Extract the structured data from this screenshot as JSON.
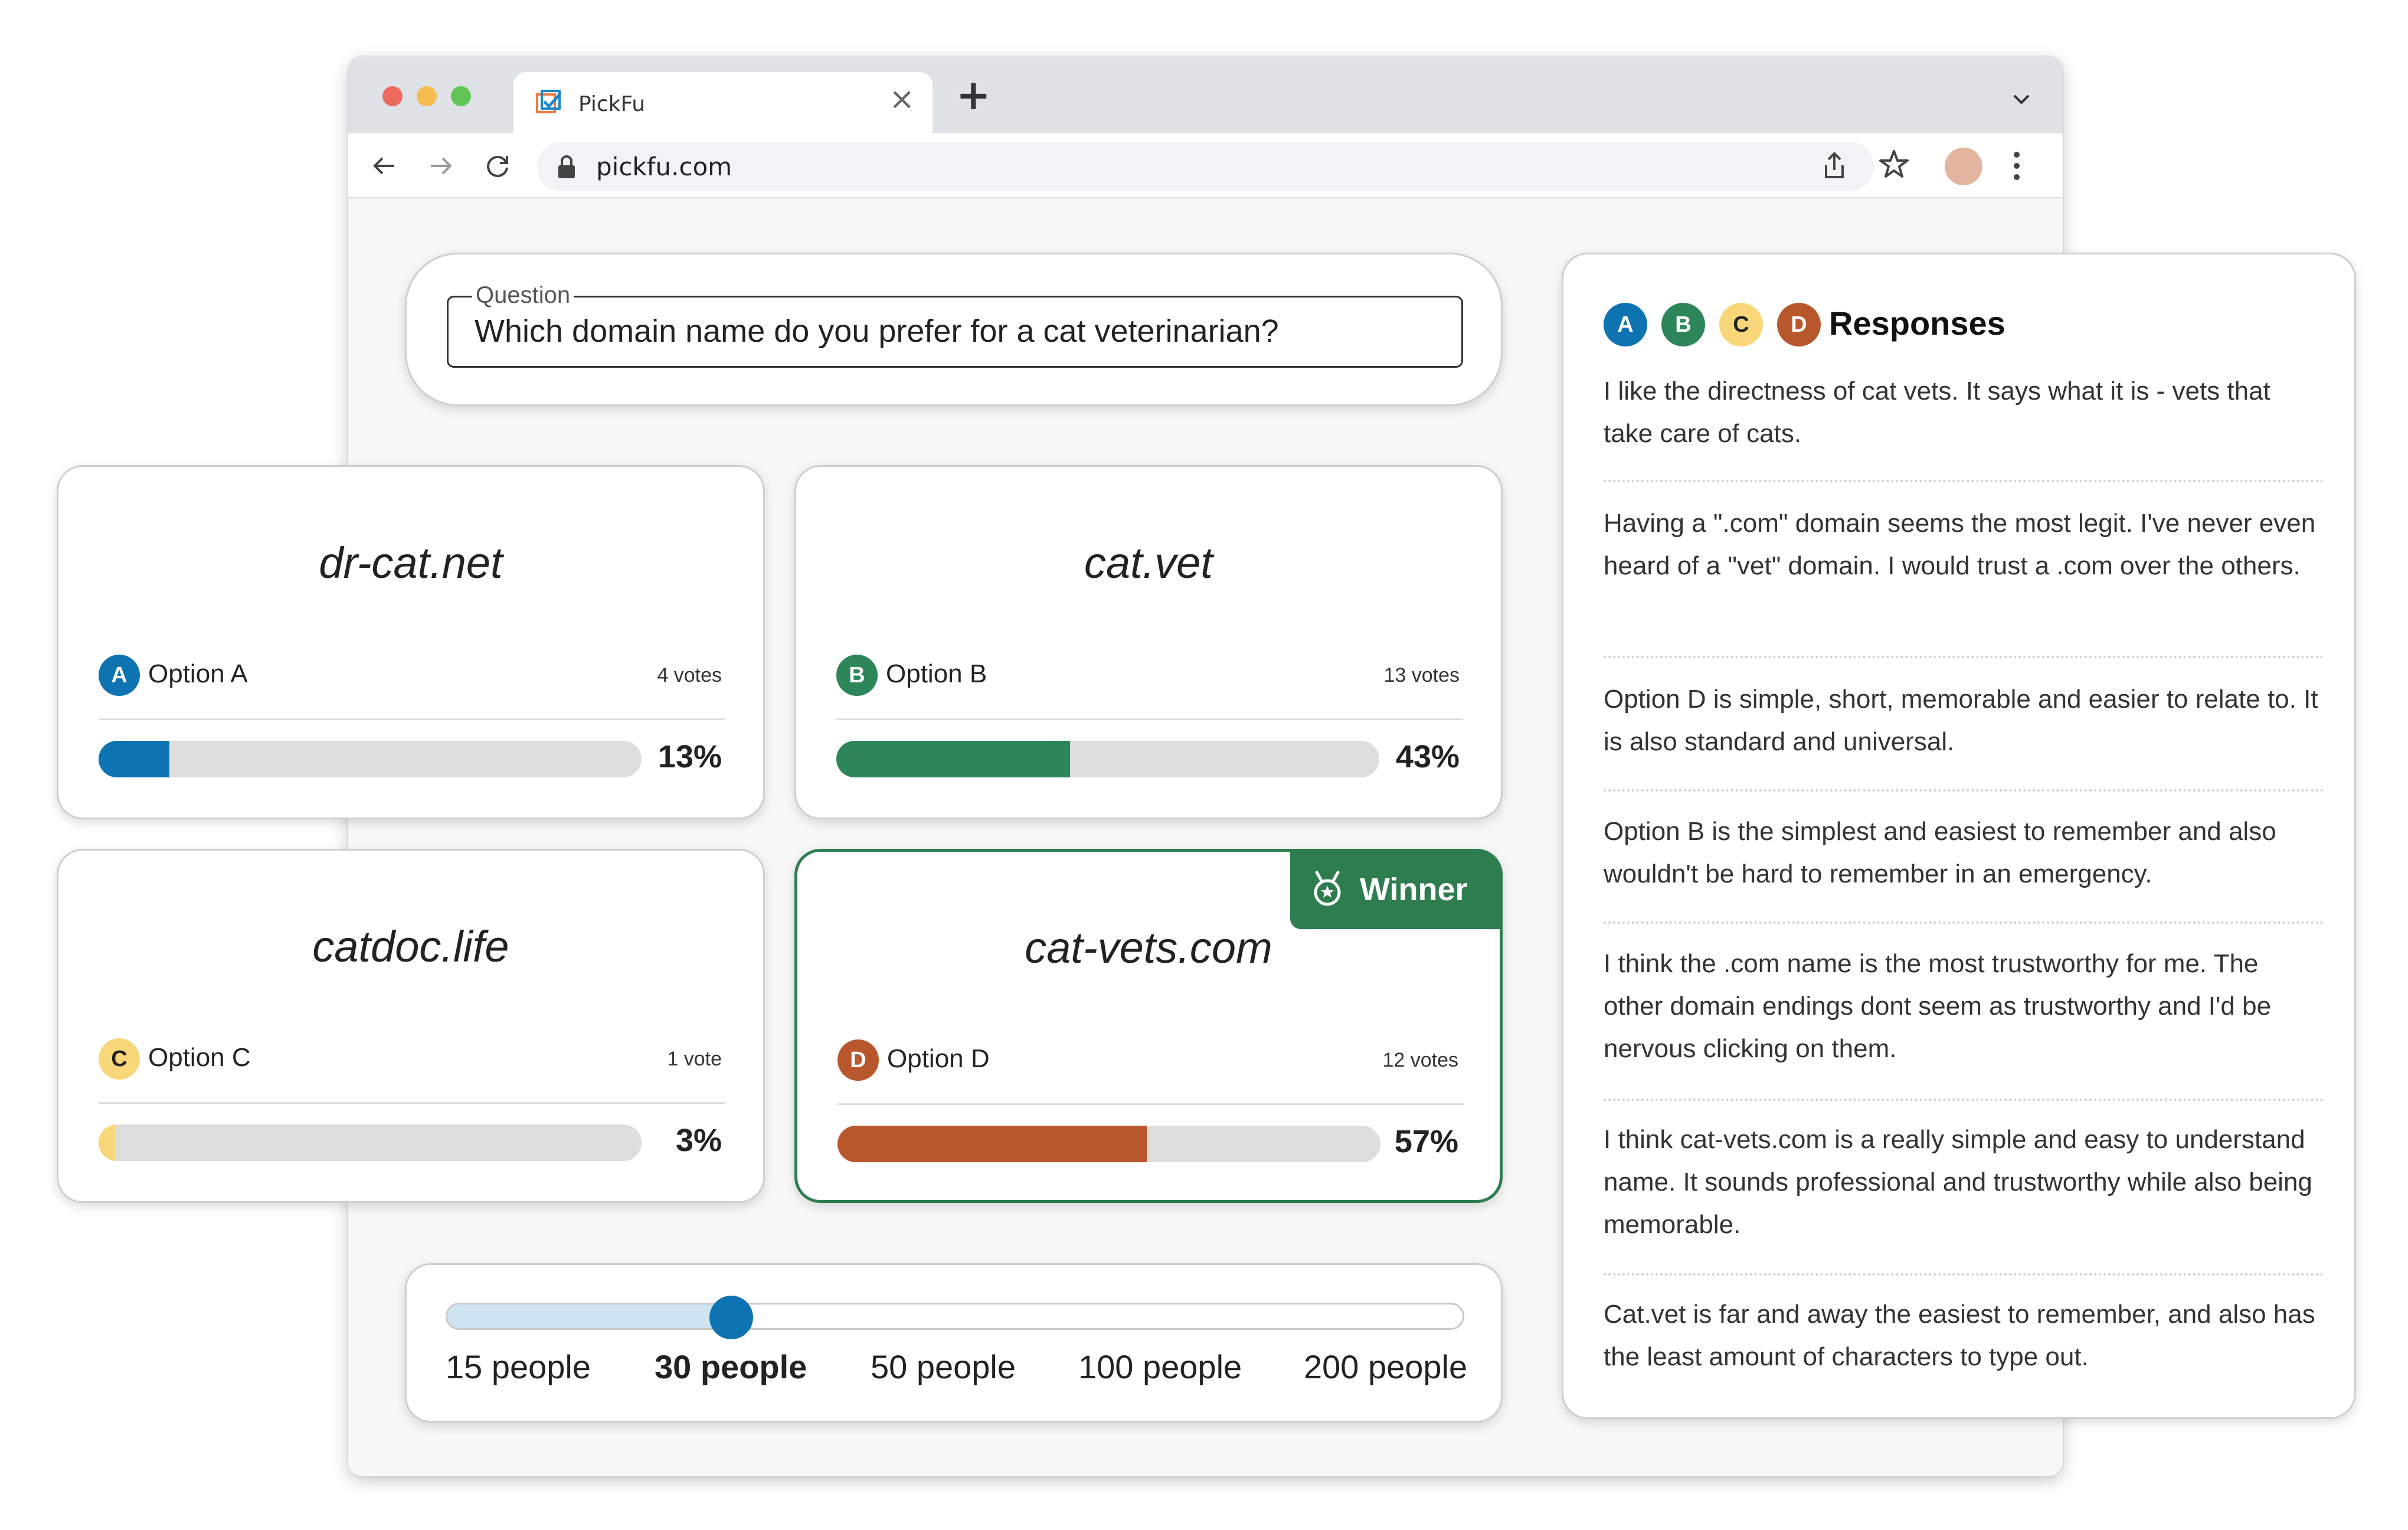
{
  "browser": {
    "tab_title": "PickFu",
    "url": "pickfu.com",
    "icons": [
      "pickfu-favicon-icon",
      "close-icon",
      "plus-icon",
      "chevron-down-icon",
      "back-arrow-icon",
      "forward-arrow-icon",
      "reload-icon",
      "lock-icon",
      "share-icon",
      "star-icon",
      "kebab-menu-icon"
    ]
  },
  "question": {
    "legend": "Question",
    "text": "Which domain name do you prefer for a cat veterinarian?"
  },
  "options": [
    {
      "letter": "A",
      "domain": "dr-cat.net",
      "label": "Option A",
      "votes": "4 votes",
      "percent_label": "13%",
      "percent": 13,
      "color": "#0d73b1"
    },
    {
      "letter": "B",
      "domain": "cat.vet",
      "label": "Option B",
      "votes": "13 votes",
      "percent_label": "43%",
      "percent": 43,
      "color": "#2d8659"
    },
    {
      "letter": "C",
      "domain": "catdoc.life",
      "label": "Option C",
      "votes": "1 vote",
      "percent_label": "3%",
      "percent": 3,
      "color": "#f7d77a"
    },
    {
      "letter": "D",
      "domain": "cat-vets.com",
      "label": "Option D",
      "votes": "12 votes",
      "percent_label": "57%",
      "percent": 57,
      "color": "#b9572c"
    }
  ],
  "winner": {
    "label": "Winner",
    "icon": "medal-icon",
    "color": "#2d7d4f"
  },
  "sample_size": {
    "options": [
      "15 people",
      "30 people",
      "50 people",
      "100 people",
      "200 people"
    ],
    "selected": "30 people",
    "accent": "#0d73b1"
  },
  "responses": {
    "title": "Responses",
    "items": [
      "I like the directness of cat vets. It says what it is - vets that take care of cats.",
      "Having a \".com\" domain seems the most legit. I've never even heard of a \"vet\" domain. I would trust a .com over the others.",
      "Option D is simple, short, memorable and easier to relate to. It is also standard and universal.",
      "Option B is the simplest and easiest to remember and also wouldn't be hard to remember in an emergency.",
      "I think the .com name is the most trustworthy for me. The other domain endings dont seem as trustworthy and I'd be nervous clicking on them.",
      "I think cat-vets.com is a really simple and easy to understand name. It sounds professional and trustworthy while also being memorable.",
      "Cat.vet is far and away the easiest to remember, and also has the least amount of characters to type out."
    ]
  }
}
